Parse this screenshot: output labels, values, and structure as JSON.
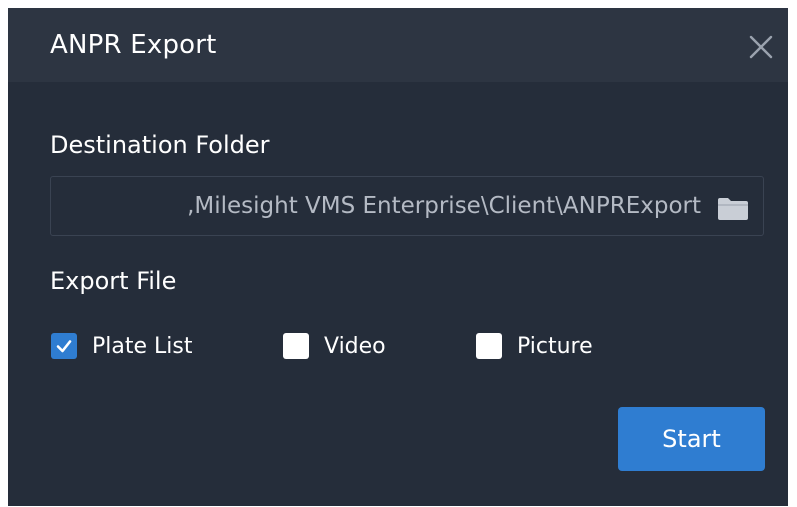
{
  "dialog": {
    "title": "ANPR Export",
    "close_icon": "close-icon"
  },
  "destination": {
    "label": "Destination Folder",
    "path_value": ",Milesight VMS Enterprise\\Client\\ANPRExport",
    "folder_icon": "folder-icon"
  },
  "export_file": {
    "label": "Export File",
    "options": [
      {
        "label": "Plate List",
        "checked": true
      },
      {
        "label": "Video",
        "checked": false
      },
      {
        "label": "Picture",
        "checked": false
      }
    ]
  },
  "actions": {
    "start_label": "Start"
  },
  "colors": {
    "dialog_bg": "#252d3a",
    "titlebar_bg": "#2d3542",
    "accent": "#2f7dd1",
    "text": "#ffffff",
    "muted_text": "#b4bac4"
  }
}
